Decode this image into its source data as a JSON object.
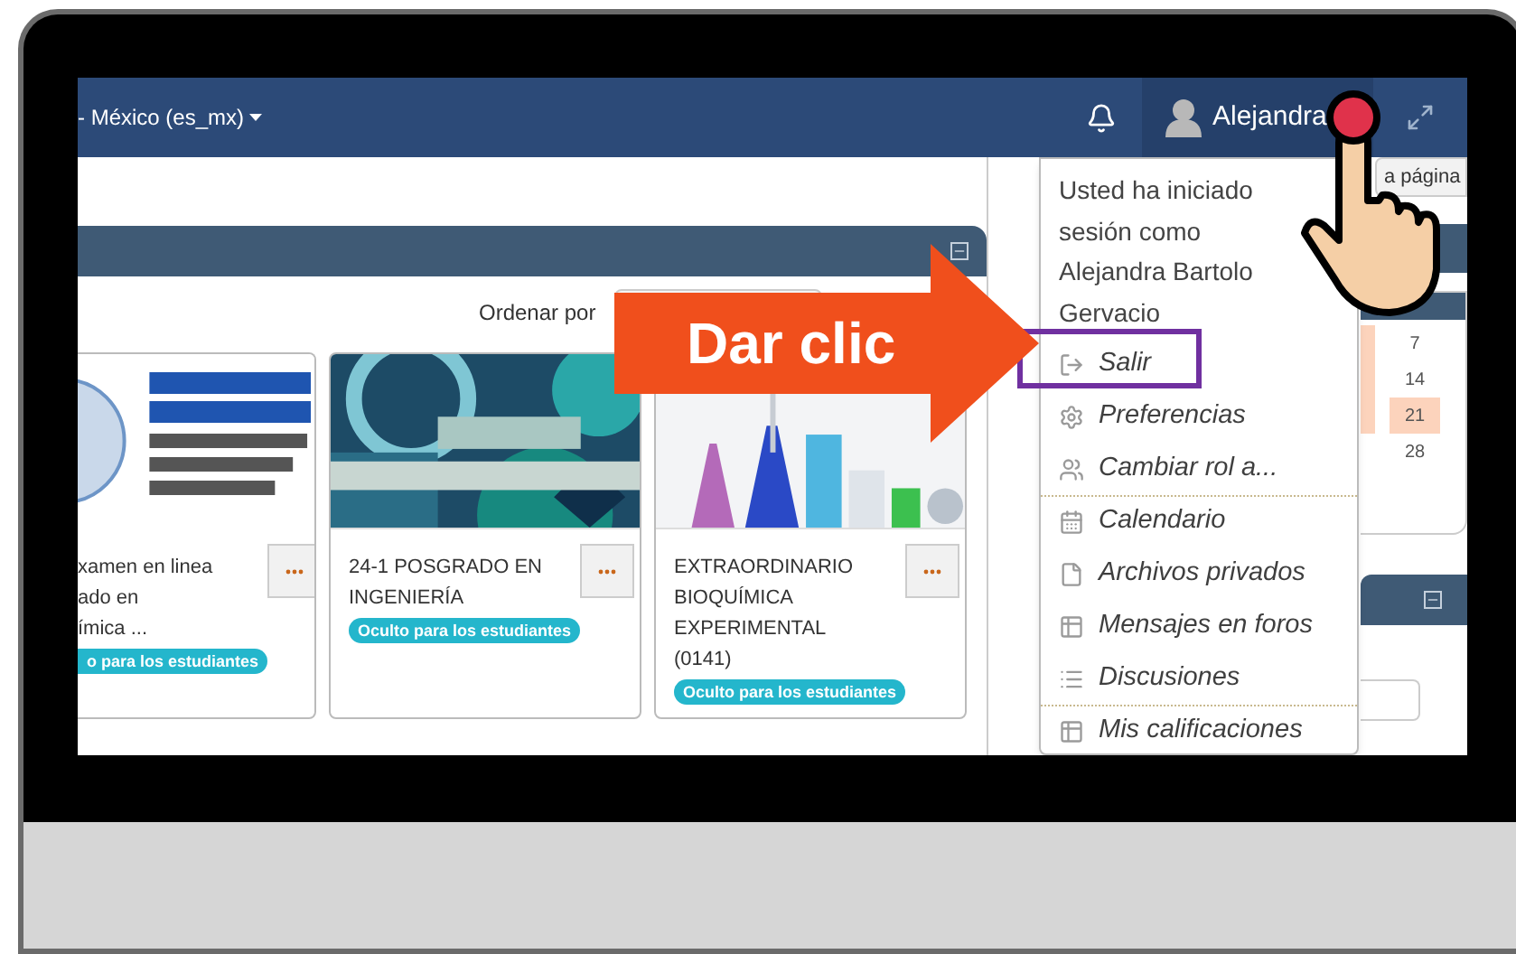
{
  "navbar": {
    "language": "- México (es_mx)",
    "user_name": "Alejandra"
  },
  "main": {
    "sort_label": "Ordenar por"
  },
  "courses": [
    {
      "title_lines": [
        "xamen en linea",
        "ado en",
        "ímica ..."
      ],
      "badge": "o para los estudiantes",
      "clipped": true
    },
    {
      "title_lines": [
        "24-1 POSGRADO EN",
        "INGENIERÍA"
      ],
      "badge": "Oculto para los estudiantes",
      "clipped": false
    },
    {
      "title_lines": [
        "EXTRAORDINARIO",
        "BIOQUÍMICA",
        "EXPERIMENTAL",
        "(0141)"
      ],
      "badge": "Oculto para los estudiantes",
      "clipped": false
    }
  ],
  "sidebar": {
    "button": "a página",
    "calendar_days": [
      {
        "day": "7",
        "highlight": false
      },
      {
        "day": "14",
        "highlight": false
      },
      {
        "day": "21",
        "highlight": true
      },
      {
        "day": "28",
        "highlight": false
      }
    ]
  },
  "user_menu": {
    "session_lines": [
      "Usted ha iniciado",
      "sesión como",
      "Alejandra Bartolo",
      "Gervacio"
    ],
    "items": [
      {
        "label": "Salir",
        "separator_before": false,
        "outlined": true
      },
      {
        "label": "Preferencias",
        "separator_before": false,
        "outlined": false
      },
      {
        "label": "Cambiar rol a...",
        "separator_before": false,
        "outlined": false
      },
      {
        "label": "Calendario",
        "separator_before": true,
        "outlined": false
      },
      {
        "label": "Archivos privados",
        "separator_before": false,
        "outlined": false
      },
      {
        "label": "Mensajes en foros",
        "separator_before": false,
        "outlined": false
      },
      {
        "label": "Discusiones",
        "separator_before": false,
        "outlined": false
      },
      {
        "label": "Mis calificaciones",
        "separator_before": true,
        "outlined": false
      }
    ]
  },
  "callout": {
    "text": "Dar clic"
  }
}
